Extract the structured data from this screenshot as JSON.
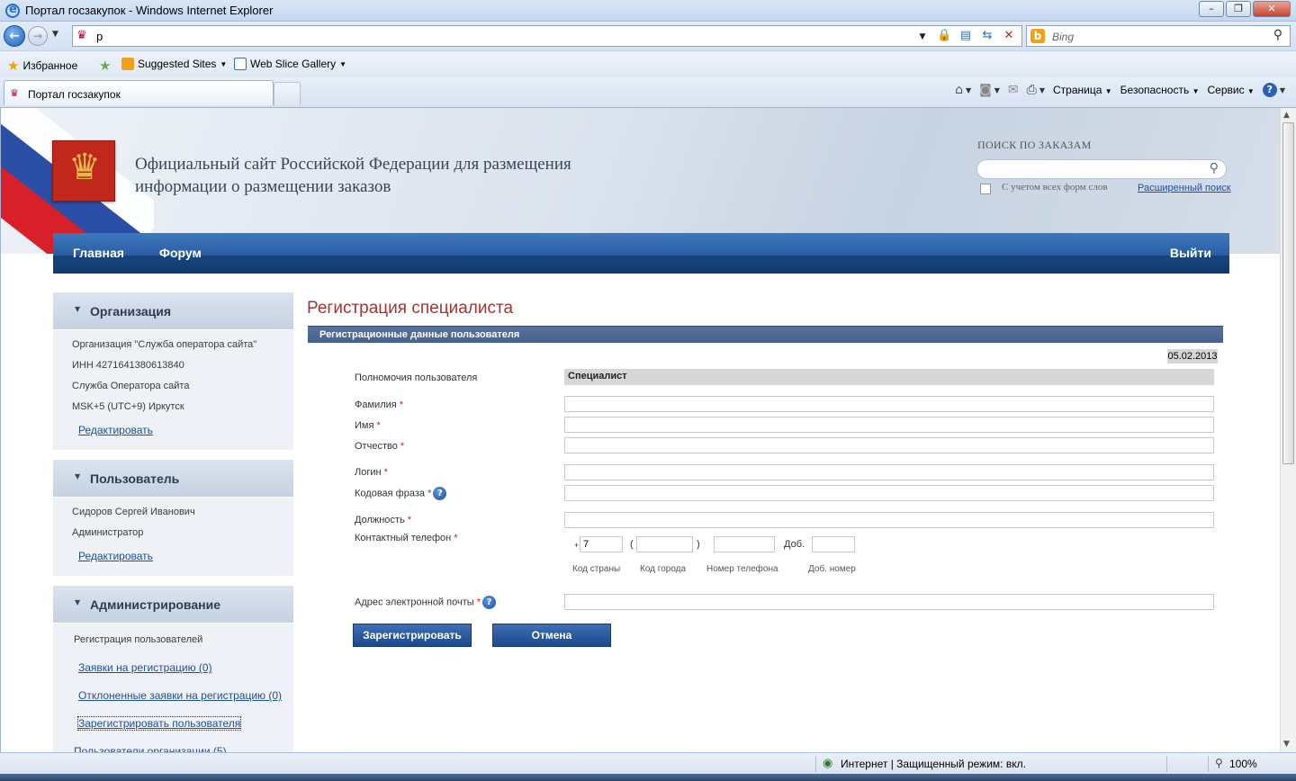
{
  "browser": {
    "window_title": "Портал госзакупок - Windows Internet Explorer",
    "address": "p",
    "search_placeholder": "Bing",
    "favorites": {
      "label": "Избранное",
      "suggested_sites": "Suggested Sites",
      "web_slice_gallery": "Web Slice Gallery"
    },
    "tab_title": "Портал госзакупок",
    "command_bar": {
      "page": "Страница",
      "safety": "Безопасность",
      "tools": "Сервис"
    },
    "status": {
      "zone": "Интернет | Защищенный режим: вкл.",
      "zoom": "100%"
    }
  },
  "site": {
    "title_line1": "Официальный сайт Российской Федерации для размещения",
    "title_line2": "информации о размещении заказов",
    "search": {
      "label": "ПОИСК ПО ЗАКАЗАМ",
      "checkbox_label": "С учетом всех форм слов",
      "advanced_link": "Расширенный поиск"
    },
    "nav": {
      "home": "Главная",
      "forum": "Форум",
      "logout": "Выйти"
    }
  },
  "sidebar": {
    "organization": {
      "title": "Организация",
      "lines": [
        "Организация \"Служба оператора сайта\"",
        "ИНН 4271641380613840",
        "Служба Оператора сайта",
        "MSK+5 (UTC+9) Иркутск"
      ],
      "edit_link": "Редактировать"
    },
    "user": {
      "title": "Пользователь",
      "lines": [
        "Сидоров Сергей Иванович",
        "Администратор"
      ],
      "edit_link": "Редактировать"
    },
    "admin": {
      "title": "Администрирование",
      "section_label": "Регистрация пользователей",
      "links": [
        "Заявки на регистрацию (0)",
        "Отклоненные заявки на регистрацию (0)",
        "Зарегистрировать пользователя",
        "Пользователи организации (5)"
      ]
    }
  },
  "form": {
    "page_title": "Регистрация специалиста",
    "section_title": "Регистрационные данные пользователя",
    "date": "05.02.2013",
    "role_label": "Полномочия пользователя",
    "role_value": "Специалист",
    "required_mark": "*",
    "fields": {
      "last_name": "Фамилия",
      "first_name": "Имя",
      "middle_name": "Отчество",
      "login": "Логин",
      "code_phrase": "Кодовая фраза",
      "position": "Должность",
      "phone": "Контактный телефон",
      "email": "Адрес электронной почты"
    },
    "phone": {
      "plus": "+",
      "country_code": "7",
      "open_paren": "(",
      "close_paren": ")",
      "ext_label": "Доб.",
      "captions": {
        "country": "Код страны",
        "city": "Код города",
        "number": "Номер телефона",
        "ext": "Доб. номер"
      }
    },
    "buttons": {
      "register": "Зарегистрировать",
      "cancel": "Отмена"
    }
  }
}
